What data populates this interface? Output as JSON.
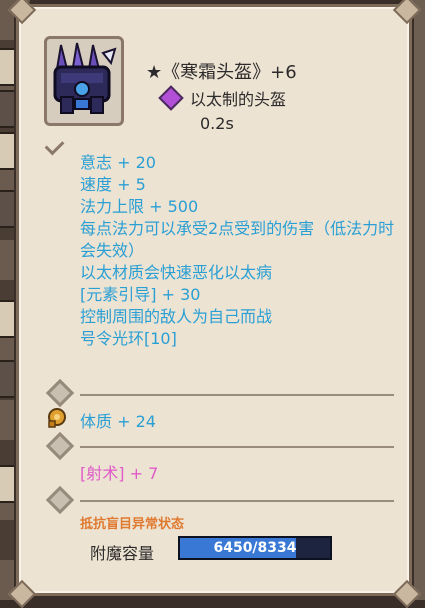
{
  "item": {
    "name": "★《寒霜头盔》+6",
    "subtitle": "以太制的头盔",
    "cooldown": "0.2s",
    "icon": "frost-helmet-icon"
  },
  "stats": [
    "意志 + 20",
    "速度 + 5",
    "法力上限 + 500",
    "每点法力可以承受2点受到的伤害（低法力时会失效）",
    "以太材质会快速恶化以太病",
    "[元素引导] + 30",
    "控制周围的敌人为自己而战",
    "号令光环[10]"
  ],
  "runes": {
    "constitution": "体质 + 24",
    "archery": "[射术] + 7"
  },
  "resist": "抵抗盲目异常状态",
  "enchant": {
    "label": "附魔容量",
    "value": "6450/8334",
    "fraction": 0.774
  },
  "colors": {
    "stat_blue": "#2a9fd4",
    "archery_pink": "#e05ac8",
    "resist_orange": "#e07a30",
    "bar_blue": "#3a78d6"
  }
}
